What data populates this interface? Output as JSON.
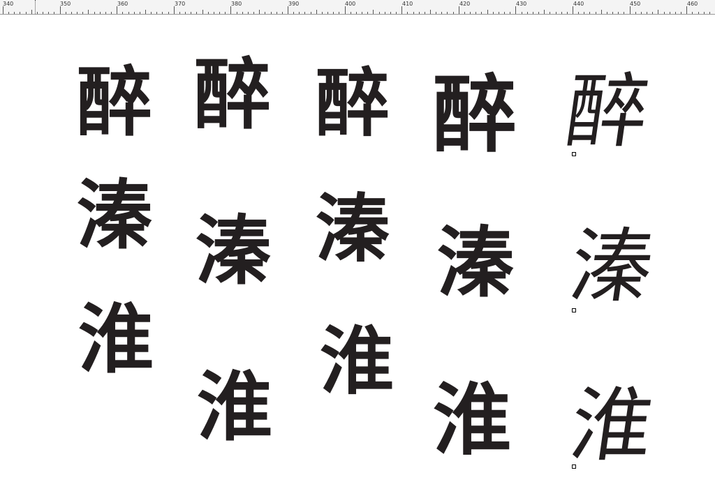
{
  "ruler": {
    "labels": [
      "340",
      "350",
      "360",
      "370",
      "380",
      "390",
      "400",
      "410",
      "420",
      "430",
      "440",
      "450",
      "460"
    ]
  },
  "glyph_columns": [
    {
      "chars": [
        "醉",
        "溱",
        "淮"
      ]
    },
    {
      "chars": [
        "醉",
        "溱",
        "淮"
      ]
    },
    {
      "chars": [
        "醉",
        "溱",
        "淮"
      ]
    },
    {
      "chars": [
        "醉",
        "溱",
        "淮"
      ]
    },
    {
      "chars": [
        "醉",
        "溱",
        "淮"
      ]
    }
  ],
  "colors": {
    "ink": "#231f20",
    "ruler_background": "#f4f4f4"
  }
}
